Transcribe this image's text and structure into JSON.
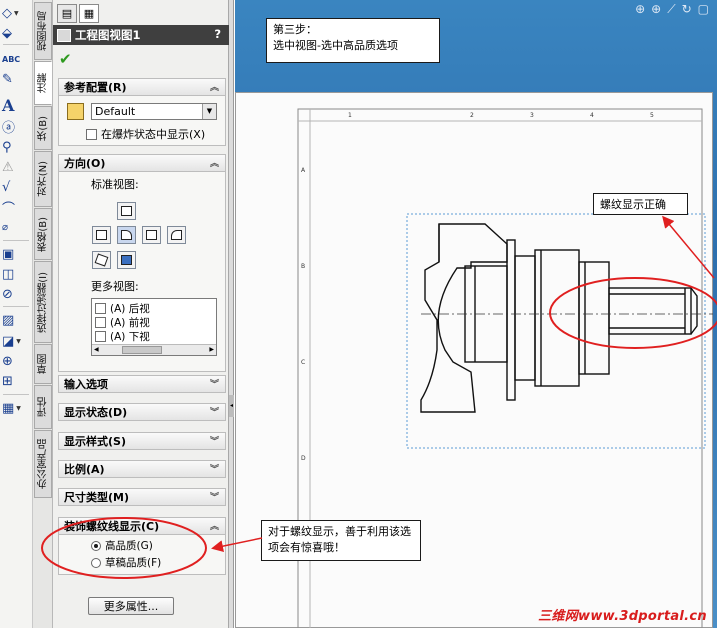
{
  "toolbar": {
    "icons": [
      "smart-dimension-icon",
      "model-items-icon",
      "spell-checker-icon",
      "format-painter-icon",
      "note-icon",
      "balloon-icon",
      "auto-balloon-icon",
      "magnetic-line-icon",
      "surface-finish-icon",
      "weld-symbol-icon",
      "hole-callout-icon",
      "geometric-tolerance-icon",
      "datum-feature-icon",
      "datum-target-icon",
      "hatch-fill-icon",
      "block-icon",
      "center-mark-icon",
      "centerline-icon",
      "table-icon"
    ]
  },
  "side_tabs": [
    "视图布局",
    "注解",
    "块(B)",
    "对齐(N)",
    "表格(B)",
    "选择过滤器(I)",
    "草图",
    "评估",
    "办公室产品"
  ],
  "property_manager": {
    "title": "工程图视图1",
    "help": "?",
    "reference_config": {
      "header": "参考配置(R)",
      "selected": "Default",
      "exploded_label": "在爆炸状态中显示(X)"
    },
    "orientation": {
      "header": "方向(O)",
      "standard_views_label": "标准视图:",
      "more_views_label": "更多视图:",
      "more_views": [
        "(A) 后视",
        "(A) 前视",
        "(A) 下视"
      ],
      "scroll_mid": "III"
    },
    "collapsed_groups": [
      "输入选项",
      "显示状态(D)",
      "显示样式(S)",
      "比例(A)",
      "尺寸类型(M)"
    ],
    "cosmetic_thread": {
      "header": "装饰螺纹线显示(C)",
      "options": [
        {
          "label": "高品质(G)",
          "selected": true
        },
        {
          "label": "草稿品质(F)",
          "selected": false
        }
      ]
    },
    "more_properties_button": "更多属性..."
  },
  "graphics": {
    "sheet_ruler_numbers": [
      "1",
      "2",
      "3",
      "4",
      "5"
    ],
    "sheet_ruler_letters": [
      "A",
      "B",
      "C",
      "D"
    ]
  },
  "annotations": {
    "step_box": [
      "第三步：",
      "选中视图-选中高品质选项"
    ],
    "thread_note": "螺纹显示正确",
    "tip_box": "对于螺纹显示，善于利用该选项会有惊喜哦！"
  },
  "watermark": "三维网www.3dportal.cn",
  "colors": {
    "pm_header": "#3f3f3f",
    "canvas_top": "#3a85c0",
    "callout_ellipse": "#e02020",
    "ok_check": "#2e9a1f"
  }
}
